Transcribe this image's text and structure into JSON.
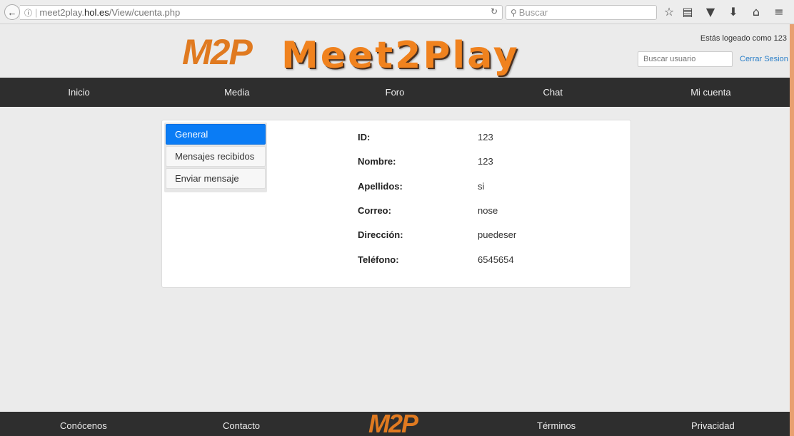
{
  "browser": {
    "url_prefix": "meet2play.",
    "url_host": "hol.es",
    "url_path": "/View/cuenta.php",
    "search_placeholder": "Buscar"
  },
  "header": {
    "logo_mark": "M2P",
    "logo_text": "Meet2Play",
    "login_status": "Estás logeado como 123",
    "user_search_placeholder": "Buscar usuario",
    "logout_label": "Cerrar Sesion"
  },
  "nav": {
    "items": [
      {
        "label": "Inicio"
      },
      {
        "label": "Media"
      },
      {
        "label": "Foro"
      },
      {
        "label": "Chat"
      },
      {
        "label": "Mi cuenta"
      }
    ]
  },
  "account": {
    "menu": [
      {
        "label": "General",
        "active": true
      },
      {
        "label": "Mensajes recibidos"
      },
      {
        "label": "Enviar mensaje"
      }
    ],
    "fields": [
      {
        "label": "ID:",
        "value": "123"
      },
      {
        "label": "Nombre:",
        "value": "123"
      },
      {
        "label": "Apellidos:",
        "value": "si"
      },
      {
        "label": "Correo:",
        "value": "nose"
      },
      {
        "label": "Dirección:",
        "value": "puedeser"
      },
      {
        "label": "Teléfono:",
        "value": "6545654"
      }
    ]
  },
  "footer": {
    "links": [
      {
        "label": "Conócenos"
      },
      {
        "label": "Contacto"
      },
      {
        "label": "Términos"
      },
      {
        "label": "Privacidad"
      }
    ],
    "logo_mark": "M2P"
  },
  "colors": {
    "accent_orange": "#f0821e",
    "nav_background": "#2e2e2e",
    "active_menu": "#0a7cf5",
    "link_blue": "#2a7fc8"
  }
}
